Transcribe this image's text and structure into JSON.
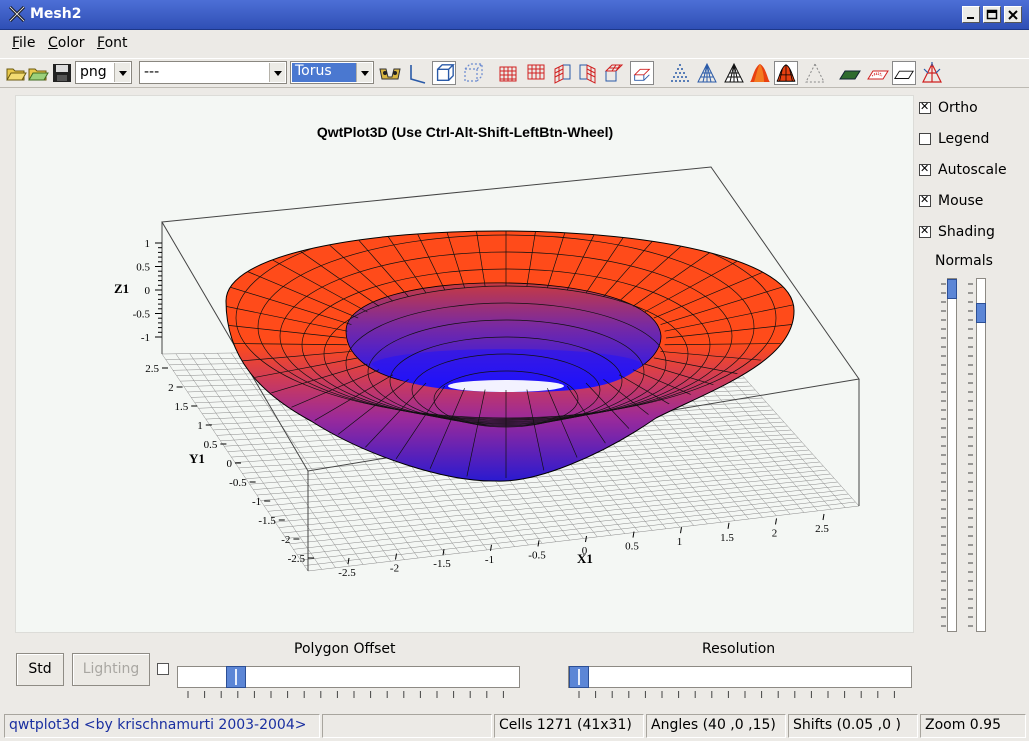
{
  "window": {
    "title": "Mesh2"
  },
  "menu": {
    "file": {
      "mnemonic": "F",
      "rest": "ile"
    },
    "color": {
      "mnemonic": "C",
      "rest": "olor"
    },
    "font": {
      "mnemonic": "F",
      "rest": "ont"
    }
  },
  "toolbar": {
    "format_combo": "png",
    "function_combo": "---",
    "surface_combo": "Torus"
  },
  "plot": {
    "title": "QwtPlot3D (Use Ctrl-Alt-Shift-LeftBtn-Wheel)",
    "x_axis_label": "X1",
    "y_axis_label": "Y1",
    "z_axis_label": "Z1",
    "x_ticks": [
      "-2.5",
      "-2",
      "-1.5",
      "-1",
      "-0.5",
      "0",
      "0.5",
      "1",
      "1.5",
      "2",
      "2.5"
    ],
    "y_ticks": [
      "2.5",
      "2",
      "1.5",
      "1",
      "0.5",
      "0",
      "-0.5",
      "-1",
      "-1.5",
      "-2",
      "-2.5"
    ],
    "z_ticks": [
      "1",
      "0.5",
      "0",
      "-0.5",
      "-1"
    ],
    "colors": {
      "surface_top": "#ff4b1a",
      "surface_bottom": "#1a1aff",
      "grid": "#8a8a8a"
    }
  },
  "options": {
    "ortho": {
      "label": "Ortho",
      "checked": true
    },
    "legend": {
      "label": "Legend",
      "checked": false
    },
    "autoscale": {
      "label": "Autoscale",
      "checked": true
    },
    "mouse": {
      "label": "Mouse",
      "checked": true
    },
    "shading": {
      "label": "Shading",
      "checked": true
    },
    "normals_label": "Normals"
  },
  "bottom": {
    "std_button": "Std",
    "lighting_button": "Lighting",
    "polygon_offset_label": "Polygon Offset",
    "resolution_label": "Resolution",
    "polygon_offset_value": 0.15,
    "resolution_value": 0.0
  },
  "status": {
    "credits": "qwtplot3d <by krischnamurti 2003-2004>",
    "cells": "Cells 1271 (41x31)",
    "angles": "Angles (40 ,0 ,15)",
    "shifts": "Shifts (0.05 ,0 )",
    "zoom": "Zoom 0.95"
  }
}
